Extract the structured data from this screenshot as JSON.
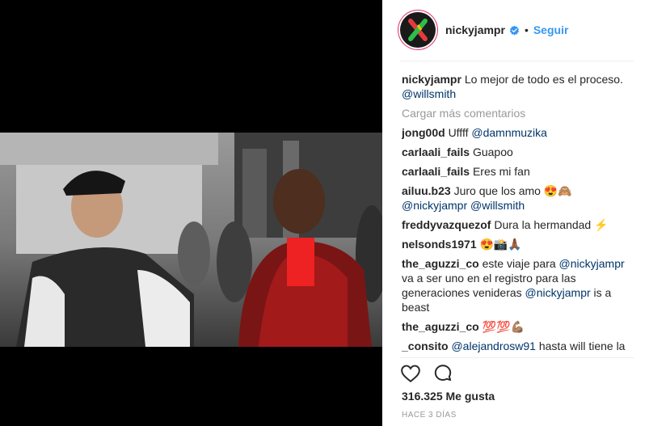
{
  "post": {
    "author": "nickyjampr",
    "follow_label": "Seguir",
    "separator_dot": "•",
    "caption": {
      "user": "nickyjampr",
      "text": "Lo mejor de todo es el proceso.",
      "mention": "@willsmith"
    },
    "load_more": "Cargar más comentarios",
    "comments": [
      {
        "user": "jong00d",
        "parts": [
          {
            "t": "text",
            "v": "Uffff "
          },
          {
            "t": "mention",
            "v": "@damnmuzika"
          }
        ]
      },
      {
        "user": "carlaali_fails",
        "parts": [
          {
            "t": "text",
            "v": "Guapoo"
          }
        ]
      },
      {
        "user": "carlaali_fails",
        "parts": [
          {
            "t": "text",
            "v": "Eres mi fan"
          }
        ]
      },
      {
        "user": "ailuu.b23",
        "parts": [
          {
            "t": "text",
            "v": "Juro que los amo 😍🙈 "
          },
          {
            "t": "mention",
            "v": "@nickyjampr"
          },
          {
            "t": "text",
            "v": " "
          },
          {
            "t": "mention",
            "v": "@willsmith"
          }
        ]
      },
      {
        "user": "freddyvazquezof",
        "parts": [
          {
            "t": "text",
            "v": "Dura la hermandad ⚡"
          }
        ]
      },
      {
        "user": "nelsonds1971",
        "parts": [
          {
            "t": "text",
            "v": "😍📸🙏🏾"
          }
        ]
      },
      {
        "user": "the_aguzzi_co",
        "parts": [
          {
            "t": "text",
            "v": "este viaje para "
          },
          {
            "t": "mention",
            "v": "@nickyjampr"
          },
          {
            "t": "text",
            "v": " va a ser uno en el registro para las generaciones venideras "
          },
          {
            "t": "mention",
            "v": "@nickyjampr"
          },
          {
            "t": "text",
            "v": " is a beast"
          }
        ]
      },
      {
        "user": "the_aguzzi_co",
        "parts": [
          {
            "t": "text",
            "v": "💯💯💪🏽"
          }
        ]
      },
      {
        "user": "_consito",
        "parts": [
          {
            "t": "mention",
            "v": "@alejandrosw91"
          },
          {
            "t": "text",
            "v": " hasta will tiene la"
          }
        ]
      }
    ],
    "likes": "316.325 Me gusta",
    "time": "HACE 3 DÍAS"
  },
  "icons": {
    "like": "heart-outline-icon",
    "comment": "comment-bubble-icon",
    "verified": "verified-badge-icon"
  },
  "colors": {
    "link": "#3897f0",
    "mention": "#003569",
    "verified": "#3897f0",
    "muted": "#999999"
  }
}
